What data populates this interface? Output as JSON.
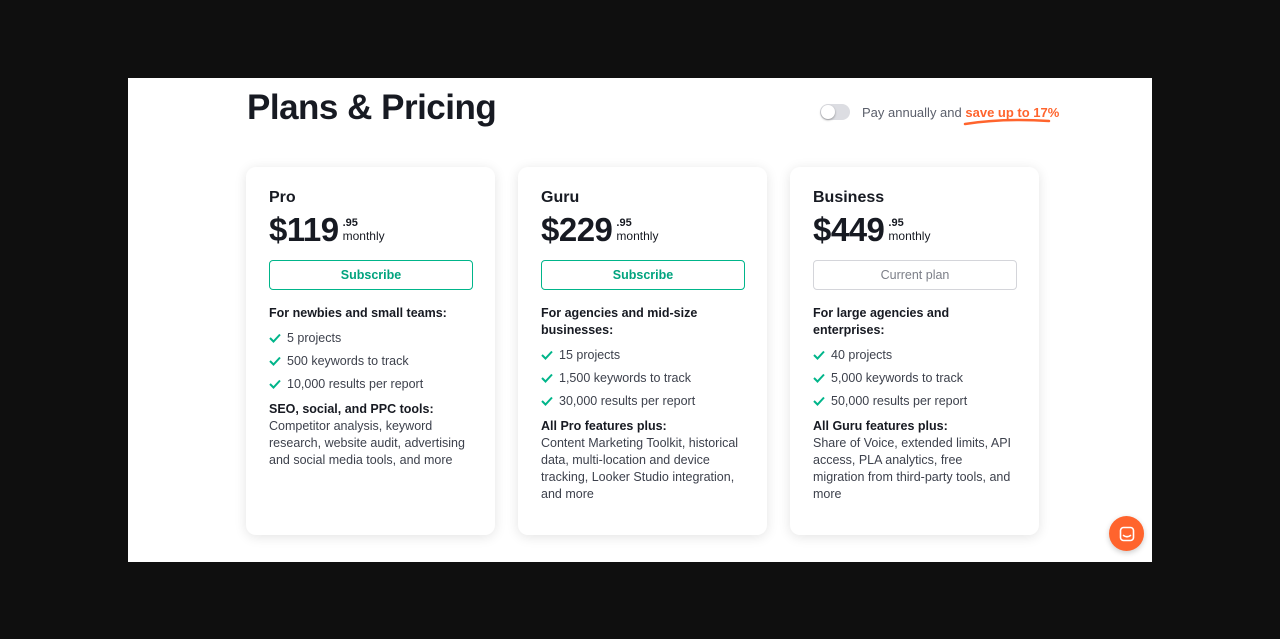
{
  "page": {
    "title": "Plans & Pricing"
  },
  "billing": {
    "toggle_on": false,
    "text": "Pay annually and",
    "save_text": "save up to 17%"
  },
  "plans": [
    {
      "name": "Pro",
      "price": "$119",
      "cents": ".95",
      "period": "monthly",
      "button": "Subscribe",
      "lead": "For newbies and small teams:",
      "features": [
        "5 projects",
        "500 keywords to track",
        "10,000 results per report"
      ],
      "extra_title": "SEO, social, and PPC tools:",
      "extra_text": "Competitor analysis, keyword research, website audit, advertising and social media tools, and more"
    },
    {
      "name": "Guru",
      "price": "$229",
      "cents": ".95",
      "period": "monthly",
      "button": "Subscribe",
      "lead": "For agencies and mid-size businesses:",
      "features": [
        "15 projects",
        "1,500 keywords to track",
        "30,000 results per report"
      ],
      "extra_title": "All Pro features plus:",
      "extra_text": "Content Marketing Toolkit, historical data, multi-location and device tracking, Looker Studio integration, and more"
    },
    {
      "name": "Business",
      "price": "$449",
      "cents": ".95",
      "period": "monthly",
      "button": "Current plan",
      "lead": "For large agencies and enterprises:",
      "features": [
        "40 projects",
        "5,000 keywords to track",
        "50,000 results per report"
      ],
      "extra_title": "All Guru features plus:",
      "extra_text": "Share of Voice, extended limits, API access, PLA analytics, free migration from third-party tools, and more"
    }
  ],
  "icons": {
    "check": "check-icon",
    "chat": "chat-icon"
  },
  "colors": {
    "accent_green": "#00b58a",
    "accent_orange": "#ff642d"
  }
}
